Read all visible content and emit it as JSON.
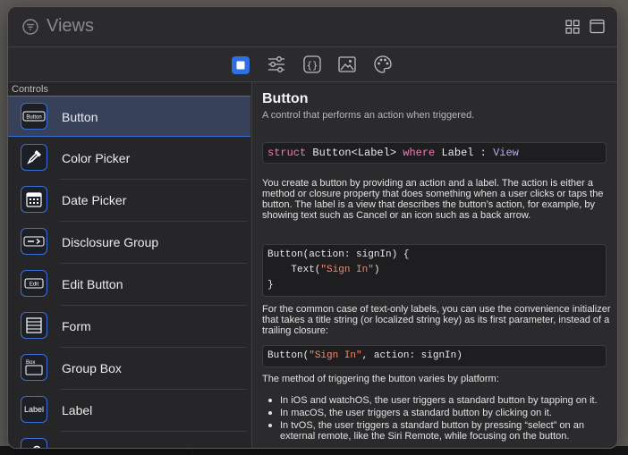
{
  "window": {
    "title": "Views"
  },
  "tabs": [
    {
      "name": "views",
      "active": true
    },
    {
      "name": "modifiers",
      "active": false
    },
    {
      "name": "snippets",
      "active": false
    },
    {
      "name": "media",
      "active": false
    },
    {
      "name": "colors",
      "active": false
    }
  ],
  "sidebar": {
    "heading": "Controls",
    "items": [
      {
        "label": "Button",
        "icon": "button-icon",
        "mini": "Button"
      },
      {
        "label": "Color Picker",
        "icon": "eyedropper-icon"
      },
      {
        "label": "Date Picker",
        "icon": "calendar-icon"
      },
      {
        "label": "Disclosure Group",
        "icon": "disclosure-icon"
      },
      {
        "label": "Edit Button",
        "icon": "edit-button-icon",
        "mini": "Edit"
      },
      {
        "label": "Form",
        "icon": "form-icon"
      },
      {
        "label": "Group Box",
        "icon": "group-box-icon",
        "mini": "Box"
      },
      {
        "label": "Label",
        "icon": "label-icon",
        "mini": "Label"
      },
      {
        "label": "",
        "icon": "link-icon"
      }
    ]
  },
  "detail": {
    "title": "Button",
    "subtitle": "A control that performs an action when triggered.",
    "declaration": {
      "kw1": "struct",
      "name": " Button<Label> ",
      "kw2": "where",
      "rest": " Label : ",
      "type": "View"
    },
    "para1": "You create a button by providing an action and a label. The action is either a method or closure property that does something when a user clicks or taps the button. The label is a view that describes the button’s action, for example, by showing text such as Cancel or an icon such as a back arrow.",
    "code1": {
      "line1": "Button(action: signIn) {",
      "line2a": "    Text(",
      "line2str": "\"Sign In\"",
      "line2b": ")",
      "line3": "}"
    },
    "para2": "For the common case of text-only labels, you can use the convenience initializer that takes a title string (or localized string key) as its first parameter, instead of a trailing closure:",
    "code2": {
      "a": "Button(",
      "str": "\"Sign In\"",
      "b": ", action: signIn)"
    },
    "para3": "The method of triggering the button varies by platform:",
    "bullets": [
      "In iOS and watchOS, the user triggers a standard button by tapping on it.",
      "In macOS, the user triggers a standard button by clicking on it.",
      "In tvOS, the user triggers a standard button by pressing “select” on an external remote, like the Siri Remote, while focusing on the button."
    ]
  },
  "colors": {
    "accent": "#2f6fe0",
    "keyword": "#f07cb9",
    "type": "#b6a7f2",
    "string": "#f08a6d"
  }
}
